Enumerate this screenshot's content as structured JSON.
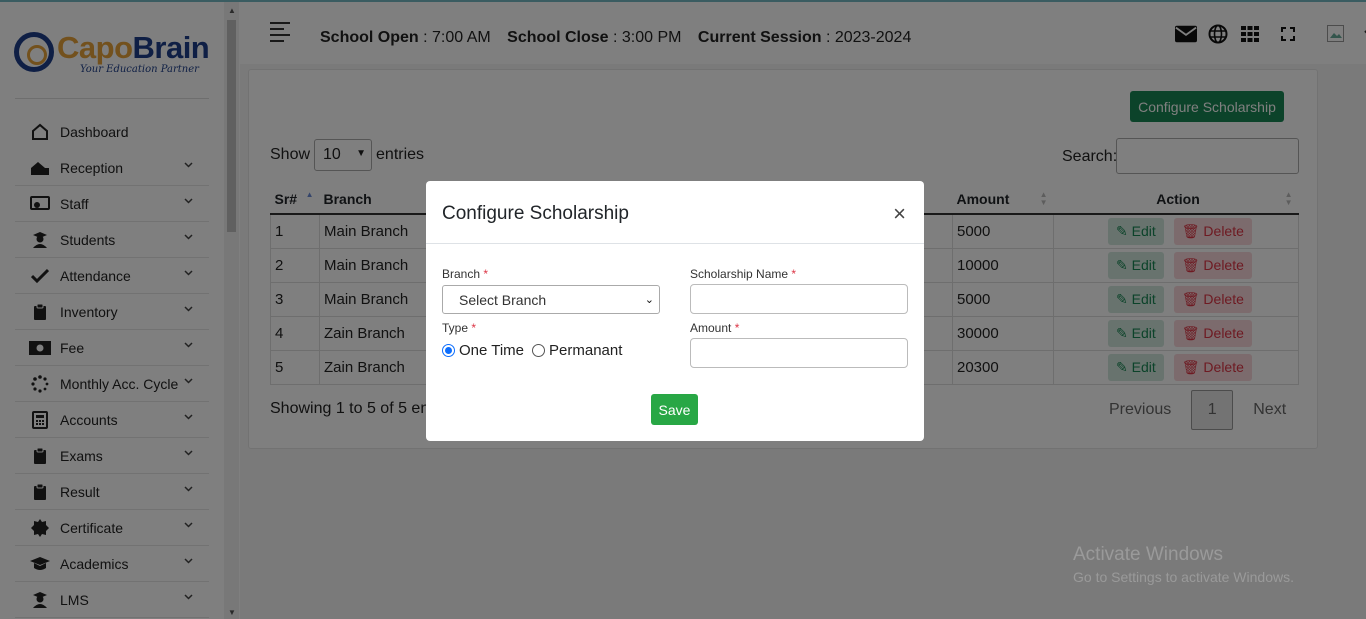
{
  "logo": {
    "part1": "Capo",
    "part2": "Brain",
    "tagline": "Your Education Partner"
  },
  "sidebar": {
    "items": [
      {
        "label": "Dashboard",
        "icon": "home-icon"
      },
      {
        "label": "Reception",
        "icon": "reception-icon"
      },
      {
        "label": "Staff",
        "icon": "staff-icon"
      },
      {
        "label": "Students",
        "icon": "student-icon"
      },
      {
        "label": "Attendance",
        "icon": "check-icon"
      },
      {
        "label": "Inventory",
        "icon": "clipboard-icon"
      },
      {
        "label": "Fee",
        "icon": "money-icon"
      },
      {
        "label": "Monthly Acc. Cycle",
        "icon": "spinner-icon"
      },
      {
        "label": "Accounts",
        "icon": "calculator-icon"
      },
      {
        "label": "Exams",
        "icon": "clipboard-icon"
      },
      {
        "label": "Result",
        "icon": "clipboard-icon"
      },
      {
        "label": "Certificate",
        "icon": "certificate-icon"
      },
      {
        "label": "Academics",
        "icon": "graduation-cap-icon"
      },
      {
        "label": "LMS",
        "icon": "student-icon"
      }
    ]
  },
  "header": {
    "open_label": "School Open",
    "open_value": " : 7:00 AM",
    "close_label": "School Close",
    "close_value": " : 3:00 PM",
    "session_label": "Current Session",
    "session_value": " : 2023-2024",
    "icons": [
      "envelope-icon",
      "globe-icon",
      "grid-icon",
      "fullscreen-icon",
      "avatar",
      "chevron-down-icon"
    ]
  },
  "page": {
    "configure_button": "Configure Scholarship",
    "show_label": "Show",
    "entries_value": "10",
    "entries_label": "entries",
    "search_label": "Search:",
    "columns": [
      "Sr#",
      "Branch",
      "Amount",
      "Action"
    ],
    "rows": [
      {
        "sr": "1",
        "branch": "Main Branch",
        "amount": "5000"
      },
      {
        "sr": "2",
        "branch": "Main Branch",
        "amount": "10000"
      },
      {
        "sr": "3",
        "branch": "Main Branch",
        "amount": "5000"
      },
      {
        "sr": "4",
        "branch": "Zain Branch",
        "amount": "30000"
      },
      {
        "sr": "5",
        "branch": "Zain Branch",
        "amount": "20300"
      }
    ],
    "edit_label": "Edit",
    "delete_label": "Delete",
    "showing_text": "Showing 1 to 5 of 5 en",
    "prev_label": "Previous",
    "page_number": "1",
    "next_label": "Next"
  },
  "modal": {
    "title": "Configure Scholarship",
    "close": "×",
    "branch_label": "Branch",
    "branch_placeholder": "Select Branch",
    "scholarship_name_label": "Scholarship Name",
    "type_label": "Type",
    "type_option1": "One Time",
    "type_option2": "Permanant",
    "type_selected": "One Time",
    "amount_label": "Amount",
    "required_mark": "*",
    "save_label": "Save"
  },
  "watermark": {
    "line1": "Activate Windows",
    "line2": "Go to Settings to activate Windows."
  },
  "colors": {
    "primary_green": "#198754",
    "save_green": "#28a745",
    "brand_blue": "#1e3f8a",
    "brand_orange": "#e6a23a",
    "delete_red": "#dc3545"
  }
}
